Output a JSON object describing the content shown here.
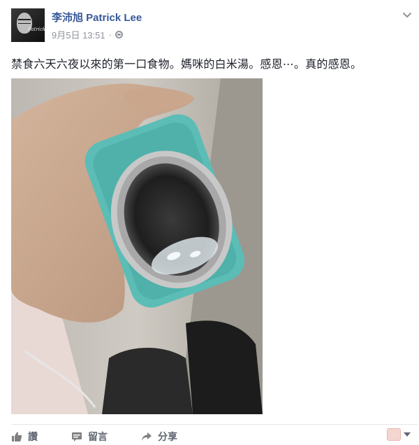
{
  "post": {
    "author": "李沛旭 Patrick Lee",
    "date": "9月5日 13:51",
    "separator": "·",
    "privacy_icon": "globe-icon",
    "menu_icon": "chevron-down-icon",
    "message": "禁食六天六夜以來的第一口食物。媽咪的白米湯。感恩⋯。真的感恩。",
    "avatar_signature": "Patrick Lee"
  },
  "photo": {
    "bottle_color": "#5bbdb6",
    "description_icon": "photo"
  },
  "actions": [
    {
      "label": "讚",
      "icon": "thumbs-up-icon"
    },
    {
      "label": "留言",
      "icon": "comment-icon"
    },
    {
      "label": "分享",
      "icon": "share-icon"
    }
  ],
  "colors": {
    "link": "#365899",
    "meta": "#90949c",
    "action_text": "#616770"
  }
}
